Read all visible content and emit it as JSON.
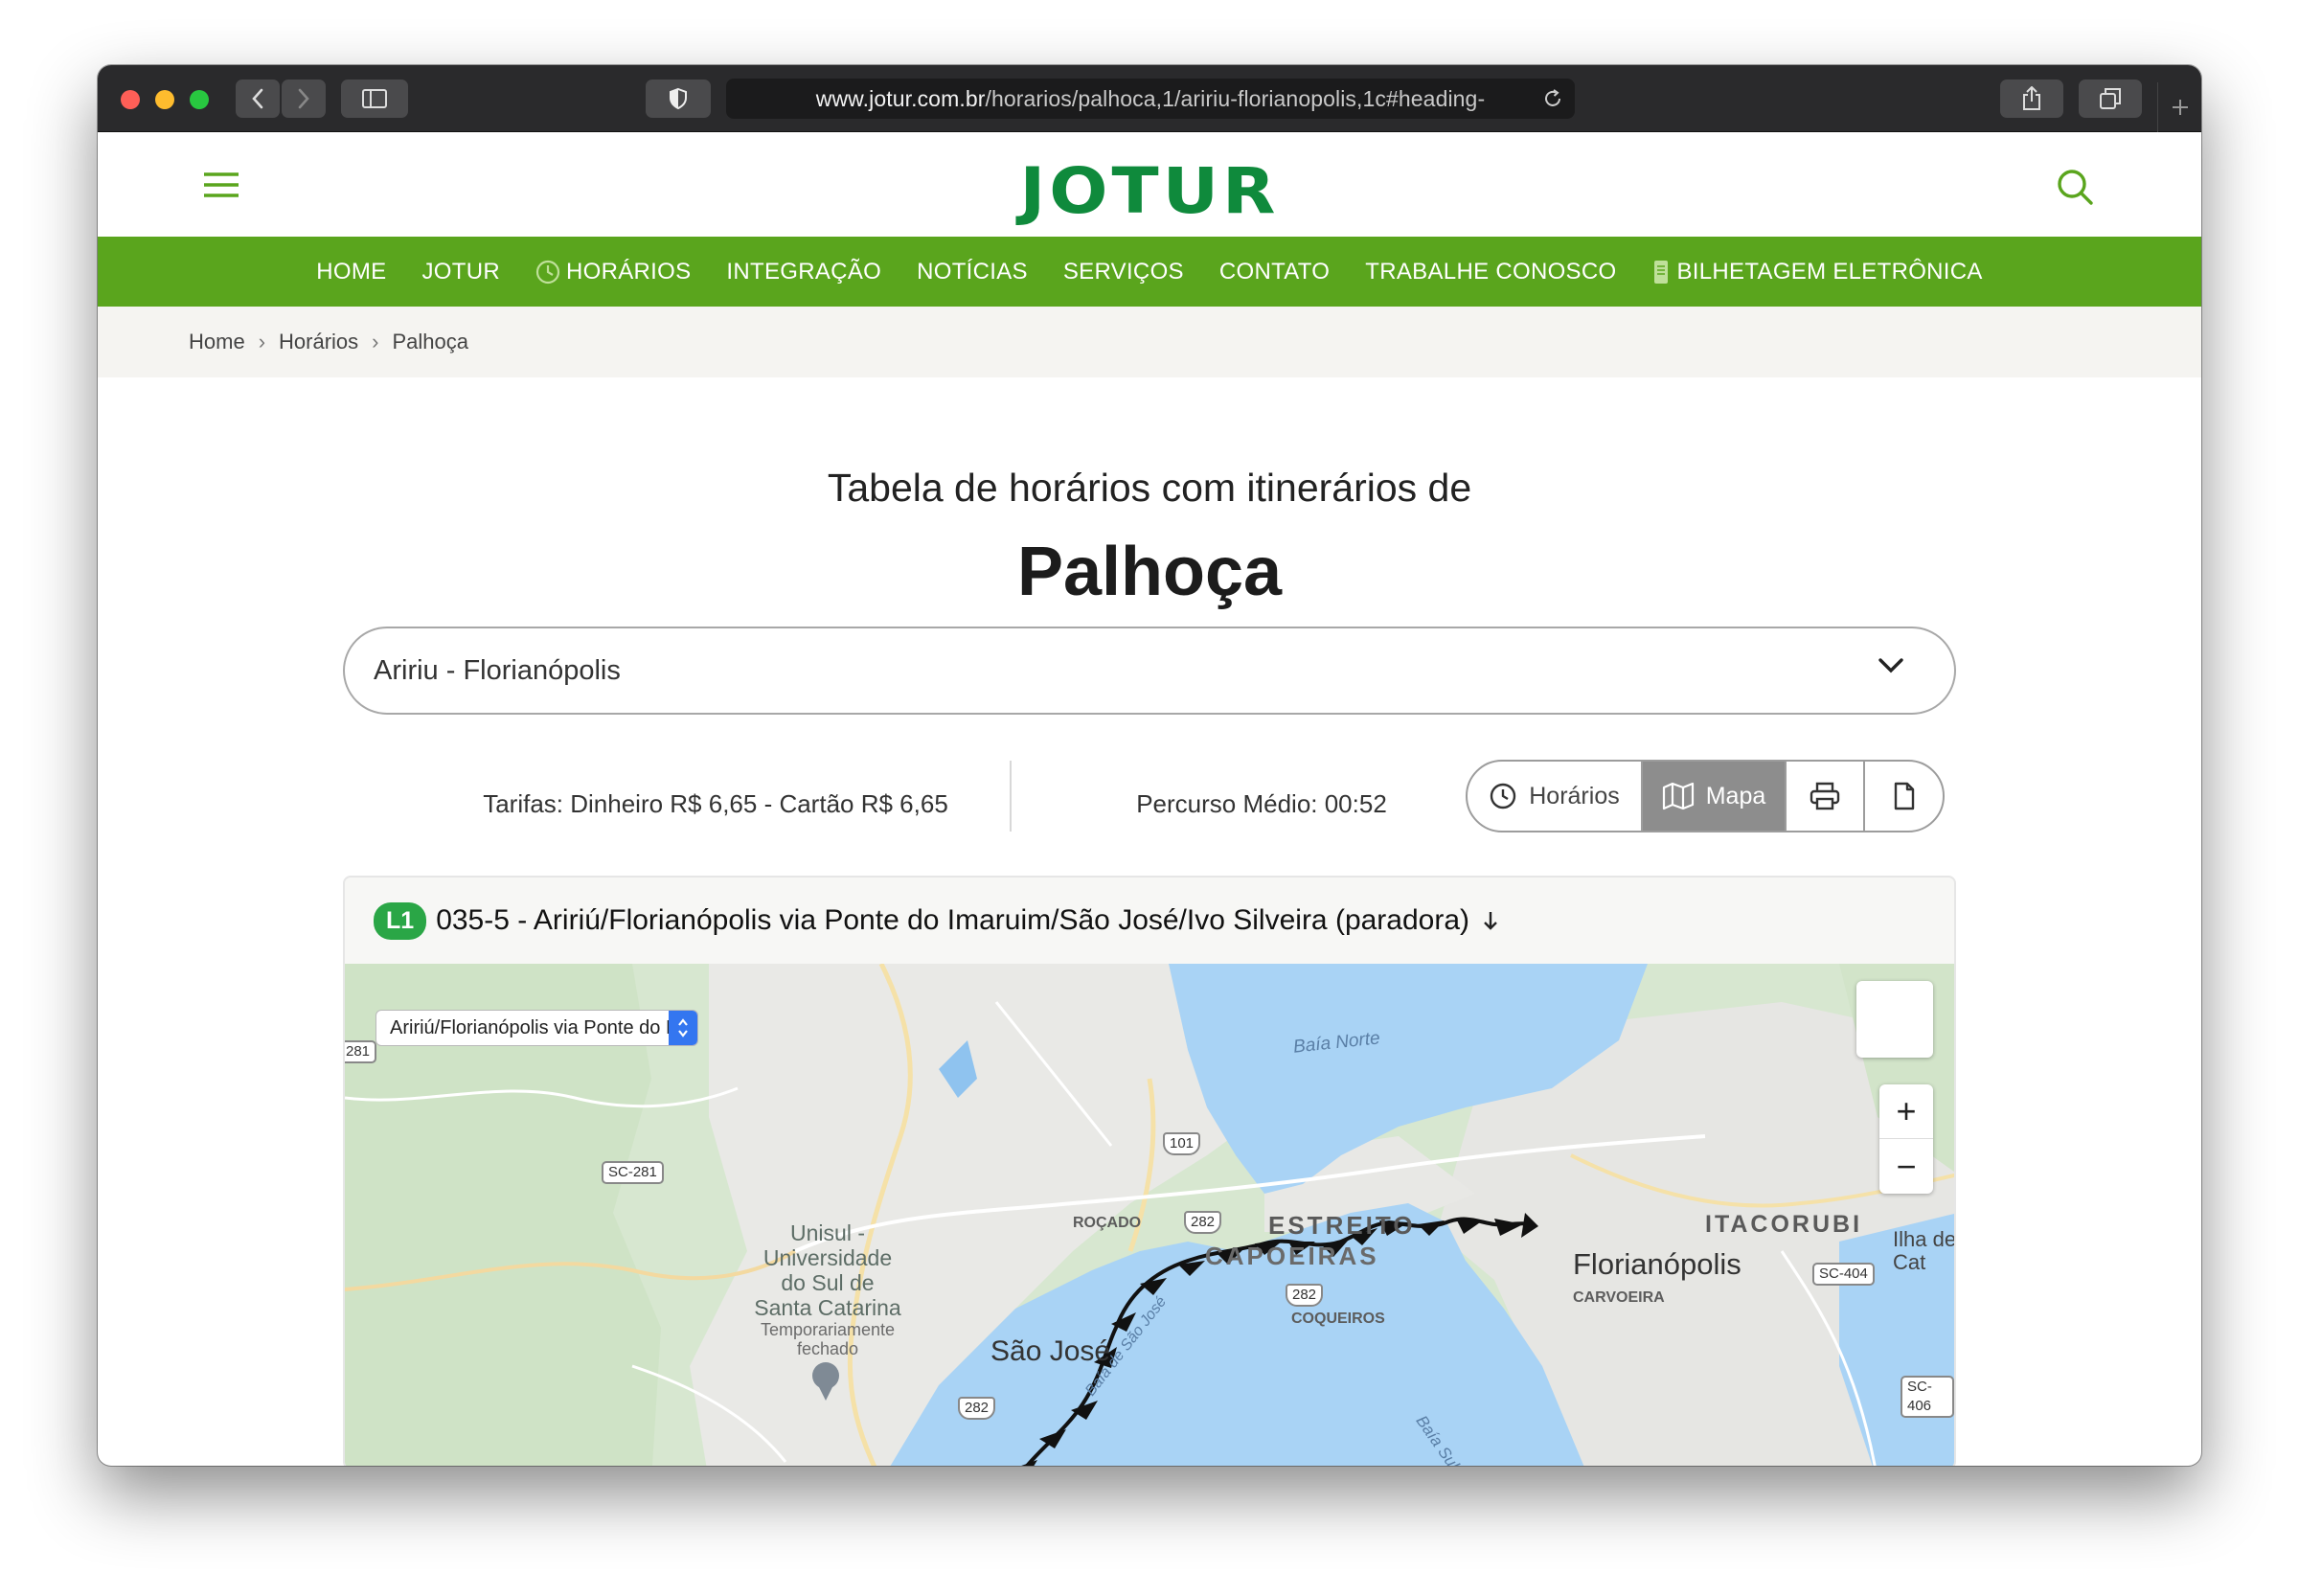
{
  "browser": {
    "url_host": "www.jotur.com.br",
    "url_path": "/horarios/palhoca,1/aririu-florianopolis,1c#heading-"
  },
  "header": {
    "logo": "JOTUR"
  },
  "nav": {
    "items": [
      {
        "label": "HOME"
      },
      {
        "label": "JOTUR"
      },
      {
        "label": "HORÁRIOS",
        "icon": "clock-icon"
      },
      {
        "label": "INTEGRAÇÃO"
      },
      {
        "label": "NOTÍCIAS"
      },
      {
        "label": "SERVIÇOS"
      },
      {
        "label": "CONTATO"
      },
      {
        "label": "TRABALHE CONOSCO"
      },
      {
        "label": "BILHETAGEM ELETRÔNICA",
        "icon": "card-icon"
      }
    ],
    "color": "#5aa51d"
  },
  "breadcrumb": [
    "Home",
    "Horários",
    "Palhoça"
  ],
  "main": {
    "heading": "Tabela de horários com itinerários de",
    "city": "Palhoça",
    "route_select": "Aririu - Florianópolis",
    "fares": "Tarifas: Dinheiro R$ 6,65 - Cartão R$ 6,65",
    "avg_route": "Percurso Médio: 00:52",
    "view_buttons": {
      "schedule": "Horários",
      "map": "Mapa",
      "selected": "Mapa"
    }
  },
  "line": {
    "badge": "L1",
    "title": "035-5 - Aririú/Florianópolis via Ponte do Imaruim/São José/Ivo Silveira (paradora)"
  },
  "map": {
    "variant_select": "Aririú/Florianópolis via Ponte do Imaruim",
    "zoom_in": "+",
    "zoom_out": "−",
    "labels": {
      "baia_norte": "Baía Norte",
      "estreito": "ESTREITO",
      "capoeiras": "CAPOEIRAS",
      "rocado": "ROÇADO",
      "coqueiros": "COQUEIROS",
      "itacorubi": "ITACORUBI",
      "florianopolis": "Florianópolis",
      "carvoeira": "CARVOEIRA",
      "ilha": "Ilha de Cat",
      "sao_jose": "São José",
      "baia_sao_jose": "Baía de São José",
      "baia_sul": "Baía Sul",
      "unisul": "Unisul -\nUniversidade\ndo Sul de\nSanta Catarina",
      "unisul_status": "Temporariamente\nfechado"
    },
    "shields": {
      "sc281": "SC-281",
      "r281": "281",
      "r101": "101",
      "r282a": "282",
      "r282b": "282",
      "r282c": "282",
      "sc404": "SC-404",
      "sc406": "SC-406"
    }
  }
}
